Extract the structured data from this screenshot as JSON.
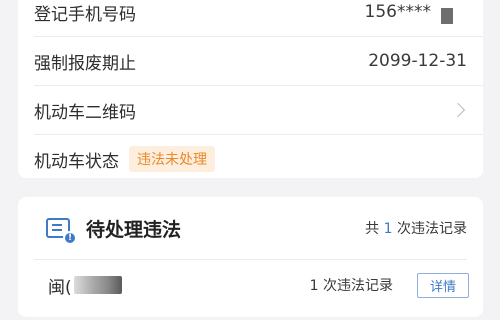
{
  "vehicle_info": {
    "phone": {
      "label": "登记手机号码",
      "value": "156****"
    },
    "scrap_deadline": {
      "label": "强制报废期止",
      "value": "2099-12-31"
    },
    "qr_code": {
      "label": "机动车二维码"
    },
    "status": {
      "label": "机动车状态",
      "badge": "违法未处理",
      "badge_color": "#e98a2c"
    }
  },
  "violations": {
    "title": "待处理违法",
    "summary_prefix": "共",
    "summary_count": "1",
    "summary_suffix": "次违法记录",
    "record": {
      "plate": "闽(",
      "count_text": "1 次违法记录",
      "detail_label": "详情"
    }
  },
  "colors": {
    "accent": "#3f79c9",
    "warning": "#e98a2c"
  }
}
